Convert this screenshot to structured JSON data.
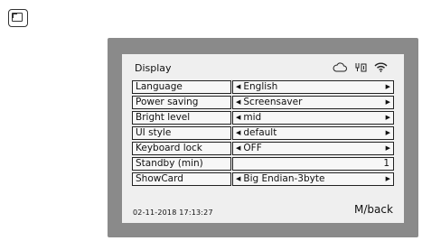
{
  "screen": {
    "title": "Display",
    "status_icons": [
      "cloud-icon",
      "usb-icon",
      "wifi-icon"
    ]
  },
  "menu": {
    "items": [
      {
        "label": "Language",
        "value": "English"
      },
      {
        "label": "Power saving",
        "value": "Screensaver"
      },
      {
        "label": "Bright level",
        "value": "mid"
      },
      {
        "label": "UI style",
        "value": "default"
      },
      {
        "label": "Keyboard lock",
        "value": "OFF"
      },
      {
        "label": "Standby (min)",
        "value": "1"
      },
      {
        "label": "ShowCard",
        "value": "Big Endian-3byte"
      }
    ]
  },
  "footer": {
    "datetime": "02-11-2018  17:13:27",
    "back_label": "M/back"
  },
  "colors": {
    "bezel": "#8a8a8a",
    "screen": "#efefef"
  }
}
